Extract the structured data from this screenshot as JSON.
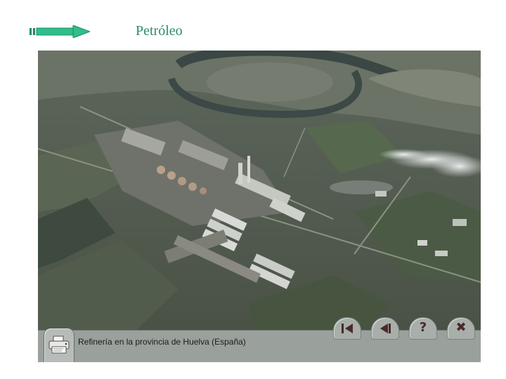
{
  "header": {
    "title": "Petróleo",
    "arrow_color": "#2fbf8a"
  },
  "photo": {
    "description_icon": "aerial-refinery-photo"
  },
  "caption": {
    "text": "Refinería en la provincia de Huelva (España)"
  },
  "toolbar": {
    "print_icon": "printer-icon",
    "buttons": [
      {
        "name": "first-button",
        "icon": "skip-back-icon"
      },
      {
        "name": "previous-button",
        "icon": "play-back-icon"
      },
      {
        "name": "help-button",
        "icon": "question-icon",
        "glyph": "?"
      },
      {
        "name": "close-button",
        "icon": "close-icon",
        "glyph": "✖"
      }
    ]
  }
}
